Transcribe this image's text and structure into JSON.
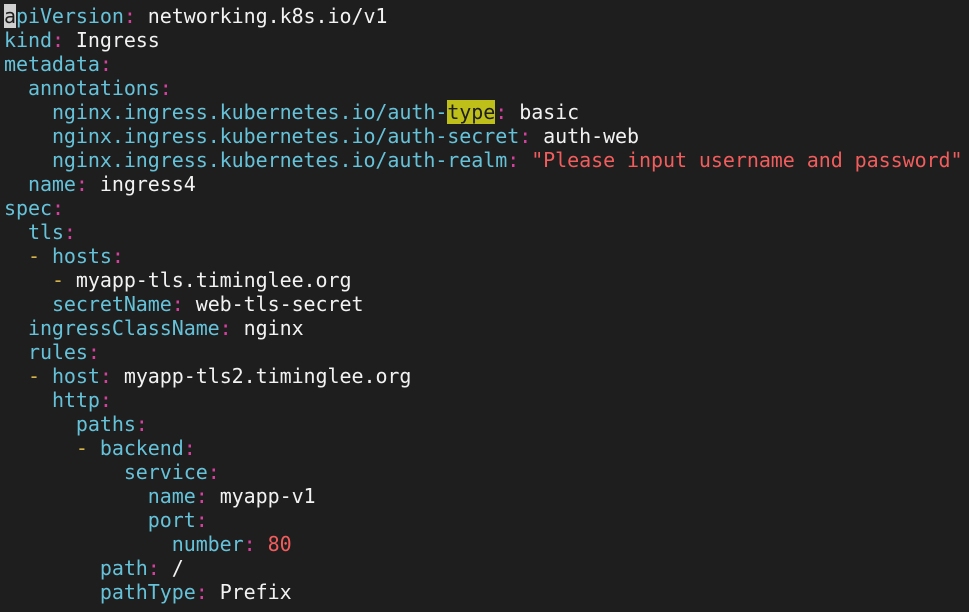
{
  "colors": {
    "background": "#1e1e1e",
    "key": "#66c2d9",
    "colon": "#d6409f",
    "value": "#f2f2f2",
    "dash": "#d6b44a",
    "string": "#f25c5c",
    "search_highlight": "#bfbf1a"
  },
  "lines": [
    {
      "indent": "",
      "cursor": "a",
      "key": "piVersion",
      "value": "networking.k8s.io/v1"
    },
    {
      "indent": "",
      "key": "kind",
      "value": "Ingress"
    },
    {
      "indent": "",
      "key": "metadata"
    },
    {
      "indent": "  ",
      "key": "annotations"
    },
    {
      "indent": "    ",
      "key_pre": "nginx.ingress.kubernetes.io/auth-",
      "key_hl": "type",
      "value": "basic"
    },
    {
      "indent": "    ",
      "key": "nginx.ingress.kubernetes.io/auth-secret",
      "value": "auth-web"
    },
    {
      "indent": "    ",
      "key": "nginx.ingress.kubernetes.io/auth-realm",
      "string": "\"Please input username and password\""
    },
    {
      "indent": "  ",
      "key": "name",
      "value": "ingress4"
    },
    {
      "indent": "",
      "key": "spec"
    },
    {
      "indent": "  ",
      "key": "tls"
    },
    {
      "indent": "  ",
      "dash": "- ",
      "key": "hosts"
    },
    {
      "indent": "    ",
      "dash": "- ",
      "item": "myapp-tls.timinglee.org"
    },
    {
      "indent": "    ",
      "key": "secretName",
      "value": "web-tls-secret"
    },
    {
      "indent": "  ",
      "key": "ingressClassName",
      "value": "nginx"
    },
    {
      "indent": "  ",
      "key": "rules"
    },
    {
      "indent": "  ",
      "dash": "- ",
      "key": "host",
      "value": "myapp-tls2.timinglee.org"
    },
    {
      "indent": "    ",
      "key": "http"
    },
    {
      "indent": "      ",
      "key": "paths"
    },
    {
      "indent": "      ",
      "dash": "- ",
      "key": "backend"
    },
    {
      "indent": "          ",
      "key": "service"
    },
    {
      "indent": "            ",
      "key": "name",
      "value": "myapp-v1"
    },
    {
      "indent": "            ",
      "key": "port"
    },
    {
      "indent": "              ",
      "key": "number",
      "number": "80"
    },
    {
      "indent": "        ",
      "key": "path",
      "value": "/"
    },
    {
      "indent": "        ",
      "key": "pathType",
      "value": "Prefix"
    }
  ]
}
